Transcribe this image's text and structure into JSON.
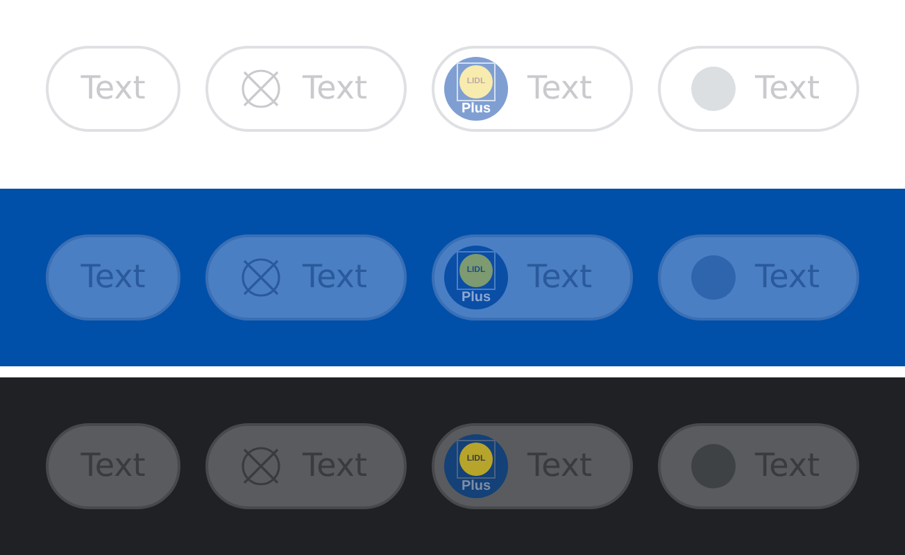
{
  "themes": [
    {
      "kind": "light",
      "chips": [
        {
          "kind": "text",
          "label": "Text",
          "disabled": true
        },
        {
          "kind": "icon",
          "label": "Text",
          "disabled": true
        },
        {
          "kind": "logo",
          "logo_text": "LIDL",
          "logo_caption": "Plus",
          "label": "Text",
          "disabled": true
        },
        {
          "kind": "avatar",
          "label": "Text",
          "disabled": true
        }
      ]
    },
    {
      "kind": "brand",
      "chips": [
        {
          "kind": "text",
          "label": "Text",
          "disabled": true
        },
        {
          "kind": "icon",
          "label": "Text",
          "disabled": true
        },
        {
          "kind": "logo",
          "logo_text": "LIDL",
          "logo_caption": "Plus",
          "label": "Text",
          "disabled": true
        },
        {
          "kind": "avatar",
          "label": "Text",
          "disabled": true
        }
      ]
    },
    {
      "kind": "dark",
      "chips": [
        {
          "kind": "text",
          "label": "Text",
          "disabled": true
        },
        {
          "kind": "icon",
          "label": "Text",
          "disabled": true
        },
        {
          "kind": "logo",
          "logo_text": "LIDL",
          "logo_caption": "Plus",
          "label": "Text",
          "disabled": true
        },
        {
          "kind": "avatar",
          "label": "Text",
          "disabled": true
        }
      ]
    }
  ]
}
